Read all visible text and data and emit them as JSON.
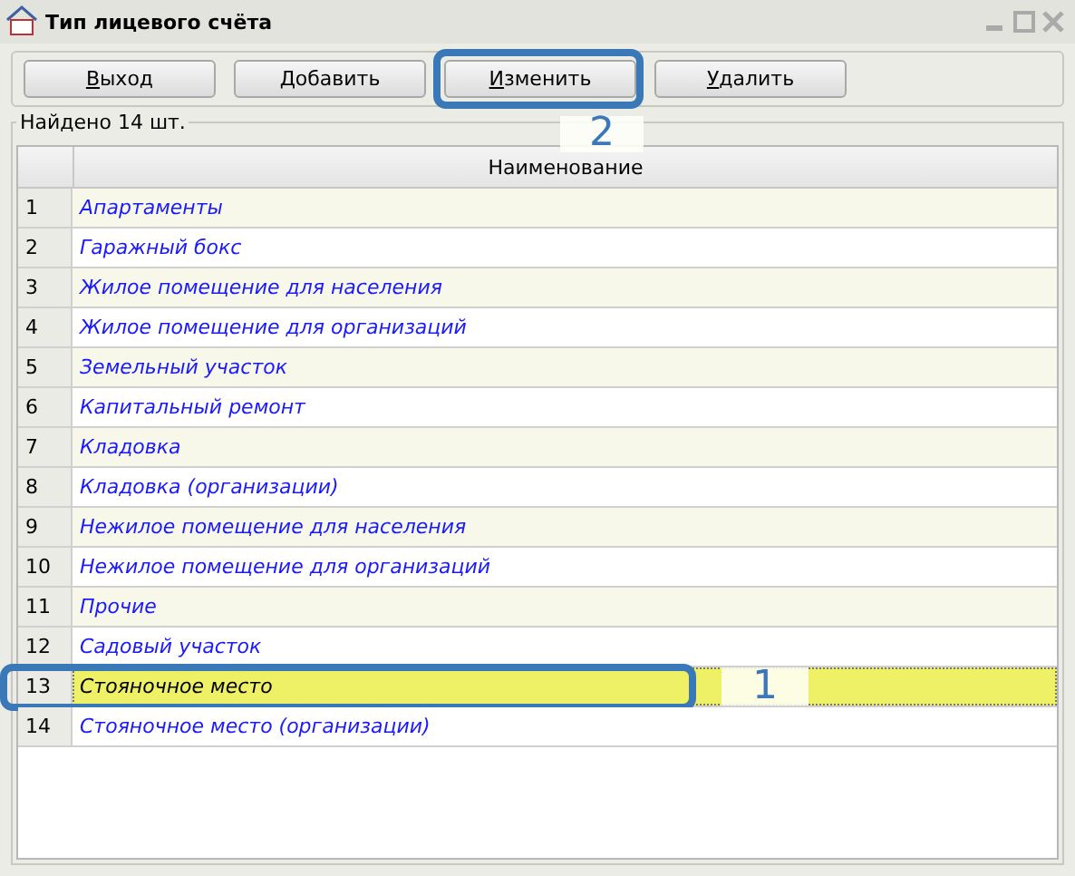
{
  "window": {
    "title": "Тип лицевого счёта"
  },
  "toolbar": [
    {
      "label": "Выход",
      "highlighted": false
    },
    {
      "label": "Добавить",
      "highlighted": false
    },
    {
      "label": "Изменить",
      "highlighted": true,
      "callout": "2"
    },
    {
      "label": "Удалить",
      "highlighted": false
    }
  ],
  "group": {
    "legend": "Найдено 14 шт."
  },
  "table": {
    "columns": [
      "Наименование"
    ],
    "rows": [
      {
        "n": "1",
        "name": "Апартаменты",
        "selected": false,
        "highlighted": false
      },
      {
        "n": "2",
        "name": "Гаражный бокс",
        "selected": false,
        "highlighted": false
      },
      {
        "n": "3",
        "name": "Жилое помещение для населения",
        "selected": false,
        "highlighted": false
      },
      {
        "n": "4",
        "name": "Жилое помещение для организаций",
        "selected": false,
        "highlighted": false
      },
      {
        "n": "5",
        "name": "Земельный участок",
        "selected": false,
        "highlighted": false
      },
      {
        "n": "6",
        "name": "Капитальный ремонт",
        "selected": false,
        "highlighted": false
      },
      {
        "n": "7",
        "name": "Кладовка",
        "selected": false,
        "highlighted": false
      },
      {
        "n": "8",
        "name": "Кладовка (организации)",
        "selected": false,
        "highlighted": false
      },
      {
        "n": "9",
        "name": "Нежилое помещение для населения",
        "selected": false,
        "highlighted": false
      },
      {
        "n": "10",
        "name": "Нежилое помещение для организаций",
        "selected": false,
        "highlighted": false
      },
      {
        "n": "11",
        "name": "Прочие",
        "selected": false,
        "highlighted": false
      },
      {
        "n": "12",
        "name": "Садовый участок",
        "selected": false,
        "highlighted": false
      },
      {
        "n": "13",
        "name": "Стояночное место",
        "selected": true,
        "highlighted": true,
        "callout": "1"
      },
      {
        "n": "14",
        "name": "Стояночное место (организации)",
        "selected": false,
        "highlighted": false
      }
    ]
  }
}
